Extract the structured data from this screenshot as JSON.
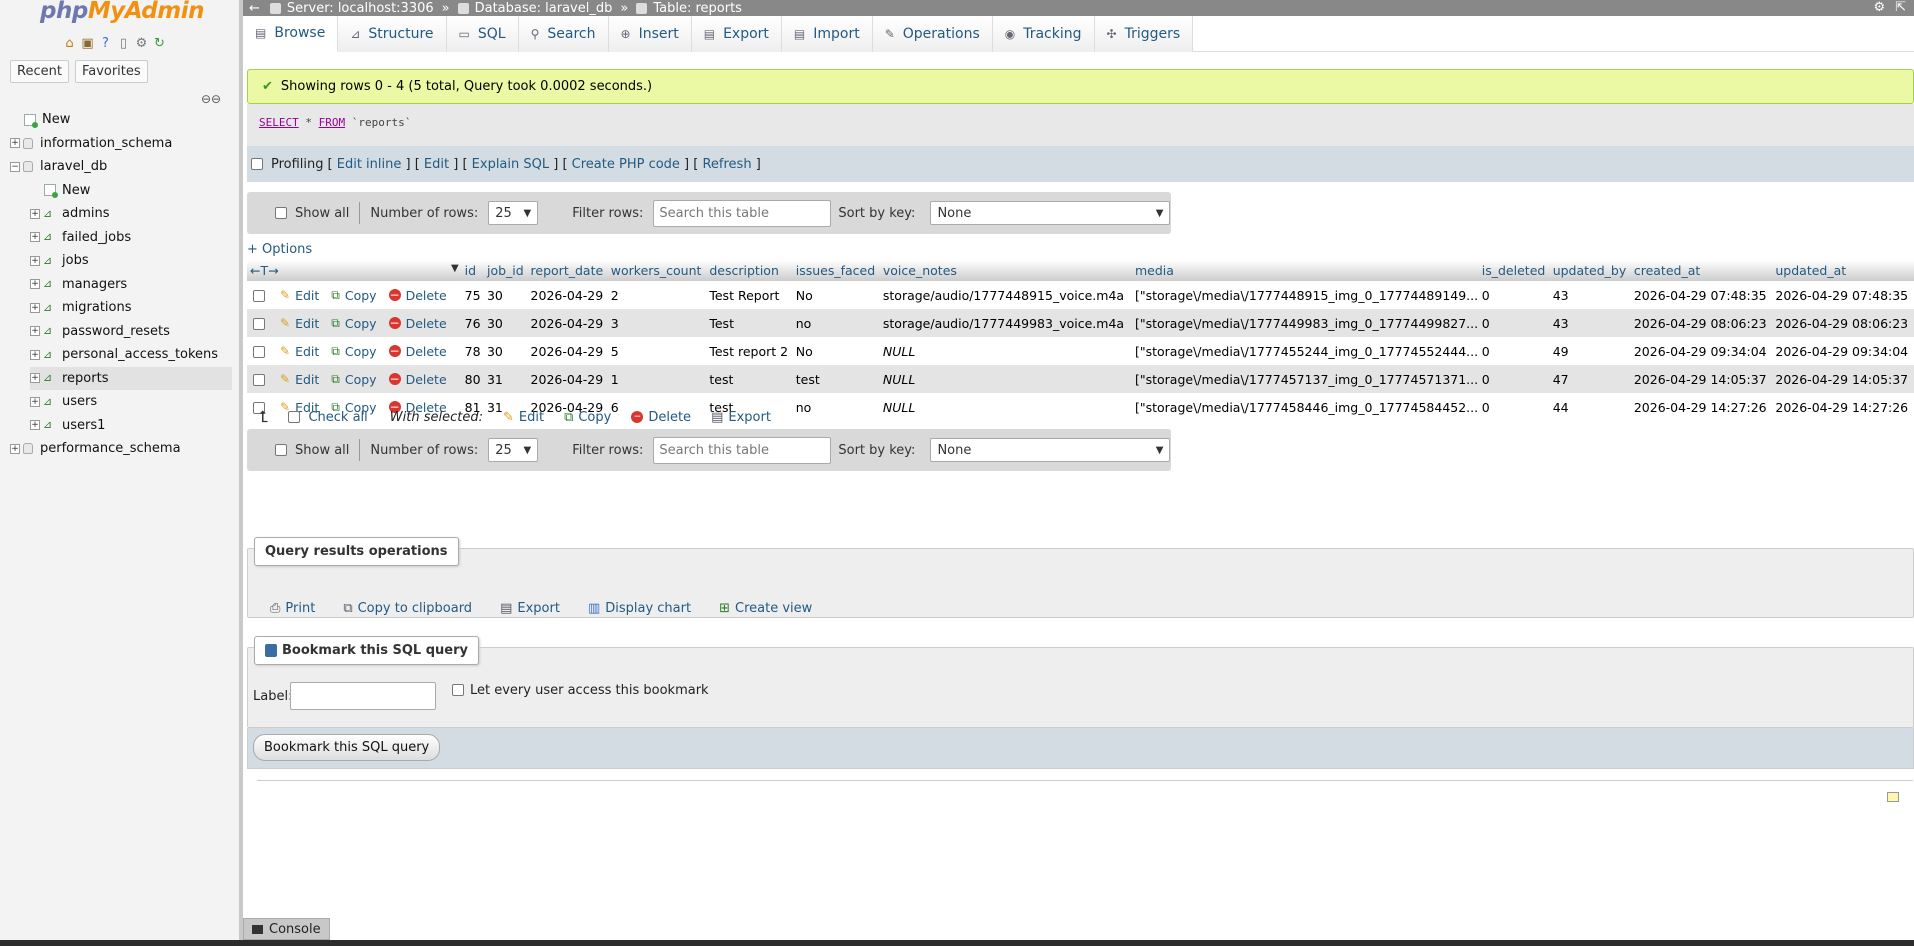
{
  "nav": {
    "logo": {
      "php": "php",
      "myadmin": "MyAdmin"
    },
    "icons": [
      "home-icon",
      "logout-icon",
      "help-icon",
      "docs-icon",
      "settings-icon",
      "reload-icon"
    ],
    "tabs": [
      "Recent",
      "Favorites"
    ],
    "tree": [
      {
        "label": "New",
        "type": "new",
        "level": 0
      },
      {
        "label": "information_schema",
        "type": "db",
        "level": 0
      },
      {
        "label": "laravel_db",
        "type": "db",
        "level": 0,
        "expanded": true
      },
      {
        "label": "New",
        "type": "new",
        "level": 1
      },
      {
        "label": "admins",
        "type": "table",
        "level": 1
      },
      {
        "label": "failed_jobs",
        "type": "table",
        "level": 1
      },
      {
        "label": "jobs",
        "type": "table",
        "level": 1
      },
      {
        "label": "managers",
        "type": "table",
        "level": 1
      },
      {
        "label": "migrations",
        "type": "table",
        "level": 1
      },
      {
        "label": "password_resets",
        "type": "table",
        "level": 1
      },
      {
        "label": "personal_access_tokens",
        "type": "table",
        "level": 1
      },
      {
        "label": "reports",
        "type": "table",
        "level": 1,
        "selected": true
      },
      {
        "label": "users",
        "type": "table",
        "level": 1
      },
      {
        "label": "users1",
        "type": "table",
        "level": 1
      },
      {
        "label": "performance_schema",
        "type": "db",
        "level": 0
      }
    ]
  },
  "topbar": {
    "server": "Server: localhost:3306",
    "database": "Database: laravel_db",
    "table": "Table: reports",
    "sep": "»"
  },
  "menu": {
    "tabs": [
      {
        "label": "Browse",
        "icon": "browse-icon",
        "active": true
      },
      {
        "label": "Structure",
        "icon": "structure-icon"
      },
      {
        "label": "SQL",
        "icon": "sql-icon"
      },
      {
        "label": "Search",
        "icon": "search-icon"
      },
      {
        "label": "Insert",
        "icon": "insert-icon"
      },
      {
        "label": "Export",
        "icon": "export-icon"
      },
      {
        "label": "Import",
        "icon": "import-icon"
      },
      {
        "label": "Operations",
        "icon": "operations-icon"
      },
      {
        "label": "Tracking",
        "icon": "tracking-icon"
      },
      {
        "label": "Triggers",
        "icon": "triggers-icon"
      }
    ]
  },
  "result": {
    "message": "Showing rows 0 - 4 (5 total, Query took 0.0002 seconds.)",
    "sql_keyword1": "SELECT",
    "sql_star": " * ",
    "sql_keyword2": "FROM",
    "sql_table": " `reports`",
    "profiling_label": "Profiling",
    "links": [
      "Edit inline",
      "Edit",
      "Explain SQL",
      "Create PHP code",
      "Refresh"
    ]
  },
  "navbar": {
    "show_all": "Show all",
    "rows_label": "Number of rows:",
    "rows_value": "25",
    "filter_label": "Filter rows:",
    "filter_placeholder": "Search this table",
    "sort_label": "Sort by key:",
    "sort_value": "None"
  },
  "options_label": "+ Options",
  "table": {
    "columns": [
      "id",
      "job_id",
      "report_date",
      "workers_count",
      "description",
      "issues_faced",
      "voice_notes",
      "media",
      "is_deleted",
      "updated_by",
      "created_at",
      "updated_at"
    ],
    "row_actions": {
      "edit": "Edit",
      "copy": "Copy",
      "delete": "Delete"
    },
    "rows": [
      [
        "75",
        "30",
        "2026-04-29",
        "2",
        "Test Report",
        "No",
        "storage/audio/1777448915_voice.m4a",
        "[\"storage\\/media\\/1777448915_img_0_17774489149...",
        "0",
        "43",
        "2026-04-29 07:48:35",
        "2026-04-29 07:48:35"
      ],
      [
        "76",
        "30",
        "2026-04-29",
        "3",
        "Test",
        "no",
        "storage/audio/1777449983_voice.m4a",
        "[\"storage\\/media\\/1777449983_img_0_17774499827...",
        "0",
        "43",
        "2026-04-29 08:06:23",
        "2026-04-29 08:06:23"
      ],
      [
        "78",
        "30",
        "2026-04-29",
        "5",
        "Test report 2",
        "No",
        "NULL",
        "[\"storage\\/media\\/1777455244_img_0_17774552444...",
        "0",
        "49",
        "2026-04-29 09:34:04",
        "2026-04-29 09:34:04"
      ],
      [
        "80",
        "31",
        "2026-04-29",
        "1",
        "test",
        "test",
        "NULL",
        "[\"storage\\/media\\/1777457137_img_0_17774571371...",
        "0",
        "47",
        "2026-04-29 14:05:37",
        "2026-04-29 14:05:37"
      ],
      [
        "81",
        "31",
        "2026-04-29",
        "6",
        "test",
        "no",
        "NULL",
        "[\"storage\\/media\\/1777458446_img_0_17774584452...",
        "0",
        "44",
        "2026-04-29 14:27:26",
        "2026-04-29 14:27:26"
      ]
    ]
  },
  "with_selected": {
    "check_all": "Check all",
    "label": "With selected:",
    "edit": "Edit",
    "copy": "Copy",
    "delete": "Delete",
    "export": "Export"
  },
  "query_ops": {
    "legend": "Query results operations",
    "print": "Print",
    "copy_clipboard": "Copy to clipboard",
    "export": "Export",
    "display_chart": "Display chart",
    "create_view": "Create view"
  },
  "bookmark": {
    "legend": "Bookmark this SQL query",
    "label": "Label:",
    "every_user": "Let every user access this bookmark",
    "button": "Bookmark this SQL query"
  },
  "console": "Console"
}
